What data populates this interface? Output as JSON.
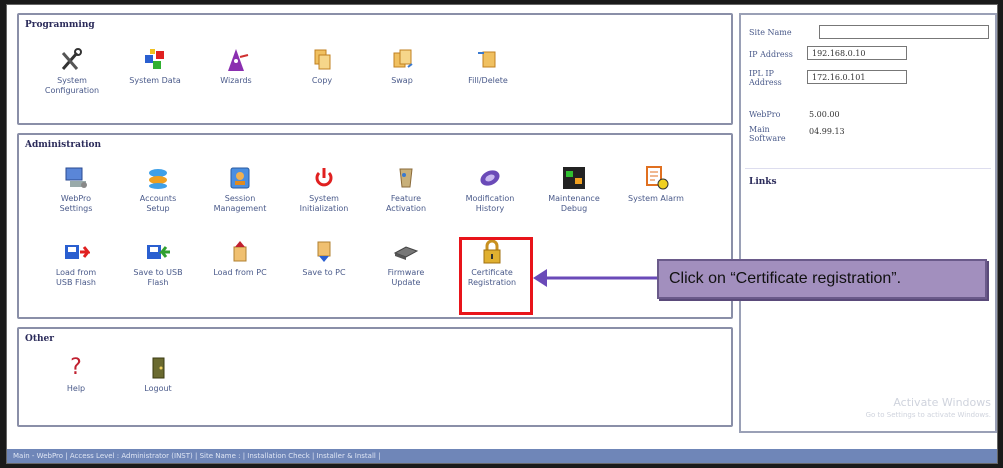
{
  "programming": {
    "title": "Programming",
    "items": [
      {
        "label": "System\nConfiguration",
        "icon": "tools-icon"
      },
      {
        "label": "System Data",
        "icon": "data-cubes-icon"
      },
      {
        "label": "Wizards",
        "icon": "wizard-icon"
      },
      {
        "label": "Copy",
        "icon": "copy-icon"
      },
      {
        "label": "Swap",
        "icon": "swap-icon"
      },
      {
        "label": "Fill/Delete",
        "icon": "fill-delete-icon"
      }
    ]
  },
  "administration": {
    "title": "Administration",
    "row1": [
      {
        "label": "WebPro\nSettings",
        "icon": "computer-settings-icon"
      },
      {
        "label": "Accounts\nSetup",
        "icon": "accounts-icon"
      },
      {
        "label": "Session\nManagement",
        "icon": "session-icon"
      },
      {
        "label": "System\nInitialization",
        "icon": "power-icon"
      },
      {
        "label": "Feature\nActivation",
        "icon": "feature-activation-icon"
      },
      {
        "label": "Modification\nHistory",
        "icon": "history-icon"
      },
      {
        "label": "Maintenance\nDebug",
        "icon": "debug-icon"
      },
      {
        "label": "System Alarm",
        "icon": "alarm-icon"
      }
    ],
    "row2": [
      {
        "label": "Load from\nUSB Flash",
        "icon": "usb-load-icon"
      },
      {
        "label": "Save to USB\nFlash",
        "icon": "usb-save-icon"
      },
      {
        "label": "Load from PC",
        "icon": "pc-load-icon"
      },
      {
        "label": "Save to PC",
        "icon": "pc-save-icon"
      },
      {
        "label": "Firmware\nUpdate",
        "icon": "firmware-icon"
      },
      {
        "label": "Certificate\nRegistration",
        "icon": "lock-icon"
      }
    ]
  },
  "other": {
    "title": "Other",
    "items": [
      {
        "label": "Help",
        "icon": "help-icon"
      },
      {
        "label": "Logout",
        "icon": "logout-icon"
      }
    ]
  },
  "info": {
    "site_name_label": "Site Name",
    "site_name_value": "",
    "ip_label": "IP Address",
    "ip_value": "192.168.0.10",
    "ipl_label": "IPL IP\nAddress",
    "ipl_value": "172.16.0.101",
    "webpro_label": "WebPro",
    "webpro_value": "5.00.00",
    "main_sw_label": "Main\nSoftware",
    "main_sw_value": "04.99.13",
    "links_title": "Links"
  },
  "watermark": {
    "title": "Activate Windows",
    "sub": "Go to Settings to activate Windows."
  },
  "statusbar": "Main - WebPro | Access Level : Administrator (INST) | Site Name : | Installation Check | Installer & Install |",
  "callout": "Click on “Certificate registration”.",
  "colors": {
    "highlight": "#e8141a",
    "callout_bg": "#a28fbe",
    "statusbar": "#6f86b8"
  }
}
